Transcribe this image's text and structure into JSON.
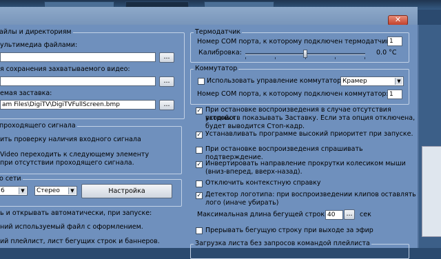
{
  "left": {
    "group_title": "айлы и директориям",
    "media_label": "ультимедиа файлами:",
    "capture_label": "я сохранения захватываемого видео:",
    "screensaver_label": "емая заставка:",
    "screensaver_path": "am Files\\DigiTV\\DigiTVFullScreen.bmp",
    "browse_label": "...",
    "signal_group_title": "проходящего сигнала",
    "signal_line1": "ить проверку наличия входного сигнала",
    "signal_line2": "Video переходить к следующему элементу",
    "signal_line3": "при отсутствии проходящего сигнала.",
    "net_group_title": "о сети",
    "net_left_value": "6",
    "stereo_value": "Стерео",
    "settings_button": "Настройка",
    "autoload_title": "ь и открывать автоматически, при запуске:",
    "autoload_line1": "ний используемый файл с оформлением.",
    "autoload_line2": "ий плейлист, лист бегущих строк и баннеров."
  },
  "thermo": {
    "title": "Термодатчик",
    "com_label": "Номер COM порта, к которому подключен термодатчик:",
    "com_value": "1",
    "calib_label": "Калибровка:",
    "calib_value": "0.0 °C",
    "calib_level": 0.5
  },
  "switcher": {
    "title": "Коммутатор",
    "use_label": "Использовать управление коммутатором",
    "use_checked": false,
    "model_value": "Крамер",
    "com_label": "Номер COM порта, к которому подключен коммутатор:",
    "com_value": "1"
  },
  "options": [
    {
      "text": [
        "При остановке воспроизведения в случае отсутствия входных",
        "устройств показывать Заставку. Если эта опция отключена,",
        "будет выводится Стоп-кадр."
      ],
      "checked": true
    },
    {
      "text": [
        "Устанавливать программе высокий приоритет при запуске."
      ],
      "checked": true
    },
    {
      "text": [
        "При остановке воспроизведения спрашивать подтверждение."
      ],
      "checked": false
    },
    {
      "text": [
        "Инвертировать направление прокрутки колесиком мыши",
        "(вниз-вперед, вверх-назад)."
      ],
      "checked": true
    },
    {
      "text": [
        "Отключить контекстную справку"
      ],
      "checked": false
    },
    {
      "text": [
        "Детектор логотипа: при воспроизведении клипов оставлять",
        "лого (иначе убирать)"
      ],
      "checked": true
    }
  ],
  "ticker": {
    "max_len_label": "Максимальная длина бегущей строки:",
    "max_len_value": "40",
    "unit": "сек",
    "interrupt_label": "Прерывать бегущую строку при выходе за эфир",
    "interrupt_checked": false
  },
  "bottom_group_title": "Загрузка листа без запросов командой плейлиста",
  "check_mark": "✓",
  "close_glyph": "✕",
  "dropdown_glyph": "▼"
}
